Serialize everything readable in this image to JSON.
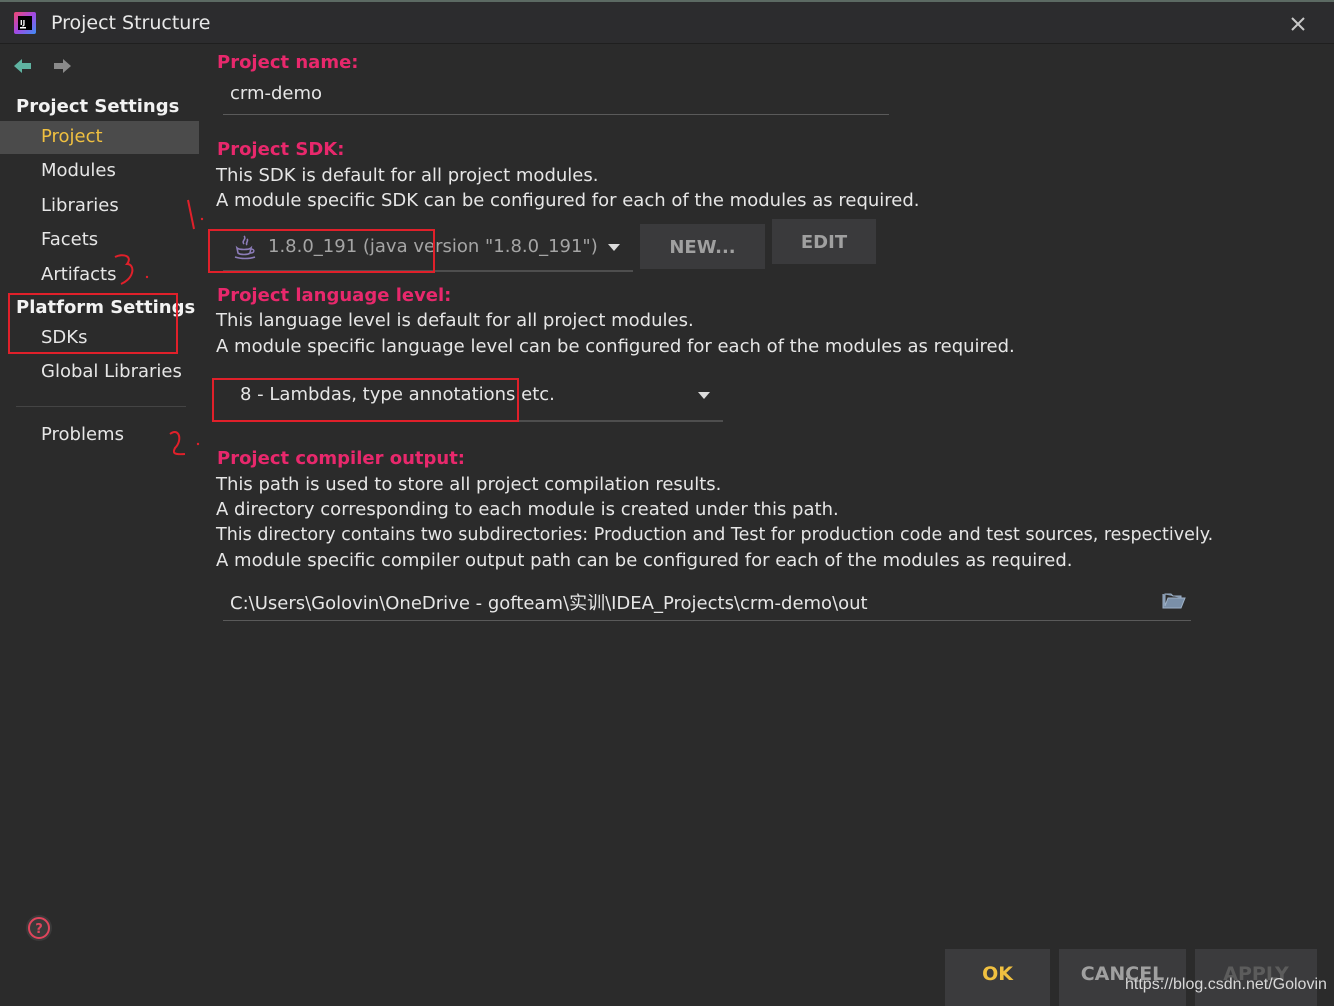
{
  "window": {
    "title": "Project Structure",
    "app_icon": "intellij-idea-icon",
    "close_icon": "close-icon"
  },
  "sidebar": {
    "back_icon": "arrow-left-icon",
    "forward_icon": "arrow-right-icon",
    "project_settings_heading": "Project Settings",
    "project_items": [
      "Project",
      "Modules",
      "Libraries",
      "Facets",
      "Artifacts"
    ],
    "active_item": "Project",
    "platform_settings_heading": "Platform Settings",
    "platform_items": [
      "SDKs",
      "Global Libraries"
    ],
    "problems_label": "Problems",
    "help_icon": "help-icon"
  },
  "main": {
    "project_name": {
      "label": "Project name:",
      "value": "crm-demo"
    },
    "project_sdk": {
      "label": "Project SDK:",
      "desc_line1": "This SDK is default for all project modules.",
      "desc_line2": "A module specific SDK can be configured for each of the modules as required.",
      "selected": "1.8.0_191 (java version \"1.8.0_191\")",
      "icon": "java-icon",
      "new_button": "NEW...",
      "edit_button": "EDIT"
    },
    "language_level": {
      "label": "Project language level:",
      "desc_line1": "This language level is default for all project modules.",
      "desc_line2": "A module specific language level can be configured for each of the modules as required.",
      "selected": "8 - Lambdas, type annotations etc."
    },
    "compiler_output": {
      "label": "Project compiler output:",
      "desc_line1": "This path is used to store all project compilation results.",
      "desc_line2": "A directory corresponding to each module is created under this path.",
      "desc_line3": "This directory contains two subdirectories: Production and Test for production code and test sources, respectively.",
      "desc_line4": "A module specific compiler output path can be configured for each of the modules as required.",
      "path": "C:\\Users\\Golovin\\OneDrive - gofteam\\实训\\IDEA_Projects\\crm-demo\\out",
      "folder_icon": "folder-open-icon"
    }
  },
  "footer": {
    "ok": "OK",
    "cancel": "CANCEL",
    "apply": "APPLY",
    "ok_color": "#f0c040"
  },
  "annotations": {
    "color": "#e0202a",
    "mark_1": "1.",
    "mark_2": "2.",
    "mark_3": "3."
  },
  "watermark": "https://blog.csdn.net/Golovin"
}
